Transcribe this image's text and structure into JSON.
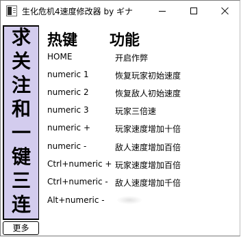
{
  "window": {
    "title": "生化危机4速度修改器 by ギナ",
    "controls": {
      "minimize_icon": "minimize-icon",
      "maximize_icon": "maximize-icon",
      "close_icon": "close-icon"
    }
  },
  "banner": {
    "chars": [
      "求",
      "关",
      "注",
      "和",
      "一",
      "键",
      "三",
      "连"
    ],
    "color": "#d3ccee"
  },
  "more_button": {
    "label": "更多"
  },
  "table": {
    "header_key": "热键",
    "header_function": "功能",
    "rows": [
      {
        "key": "HOME",
        "desc": "开启作弊"
      },
      {
        "key": "numeric 1",
        "desc": "恢复玩家初始速度"
      },
      {
        "key": "numeric 2",
        "desc": "恢复敌人初始速度"
      },
      {
        "key": "numeric 3",
        "desc": "玩家三倍速"
      },
      {
        "key": "numeric +",
        "desc": "玩家速度增加十倍"
      },
      {
        "key": "numeric -",
        "desc": "敌人速度增加百倍"
      },
      {
        "key": "Ctrl+numeric +",
        "desc": "玩家速度增加百倍"
      },
      {
        "key": "Ctrl+numeric -",
        "desc": "敌人速度增加千倍"
      },
      {
        "key": "Alt+numeric -",
        "desc": ""
      }
    ]
  }
}
